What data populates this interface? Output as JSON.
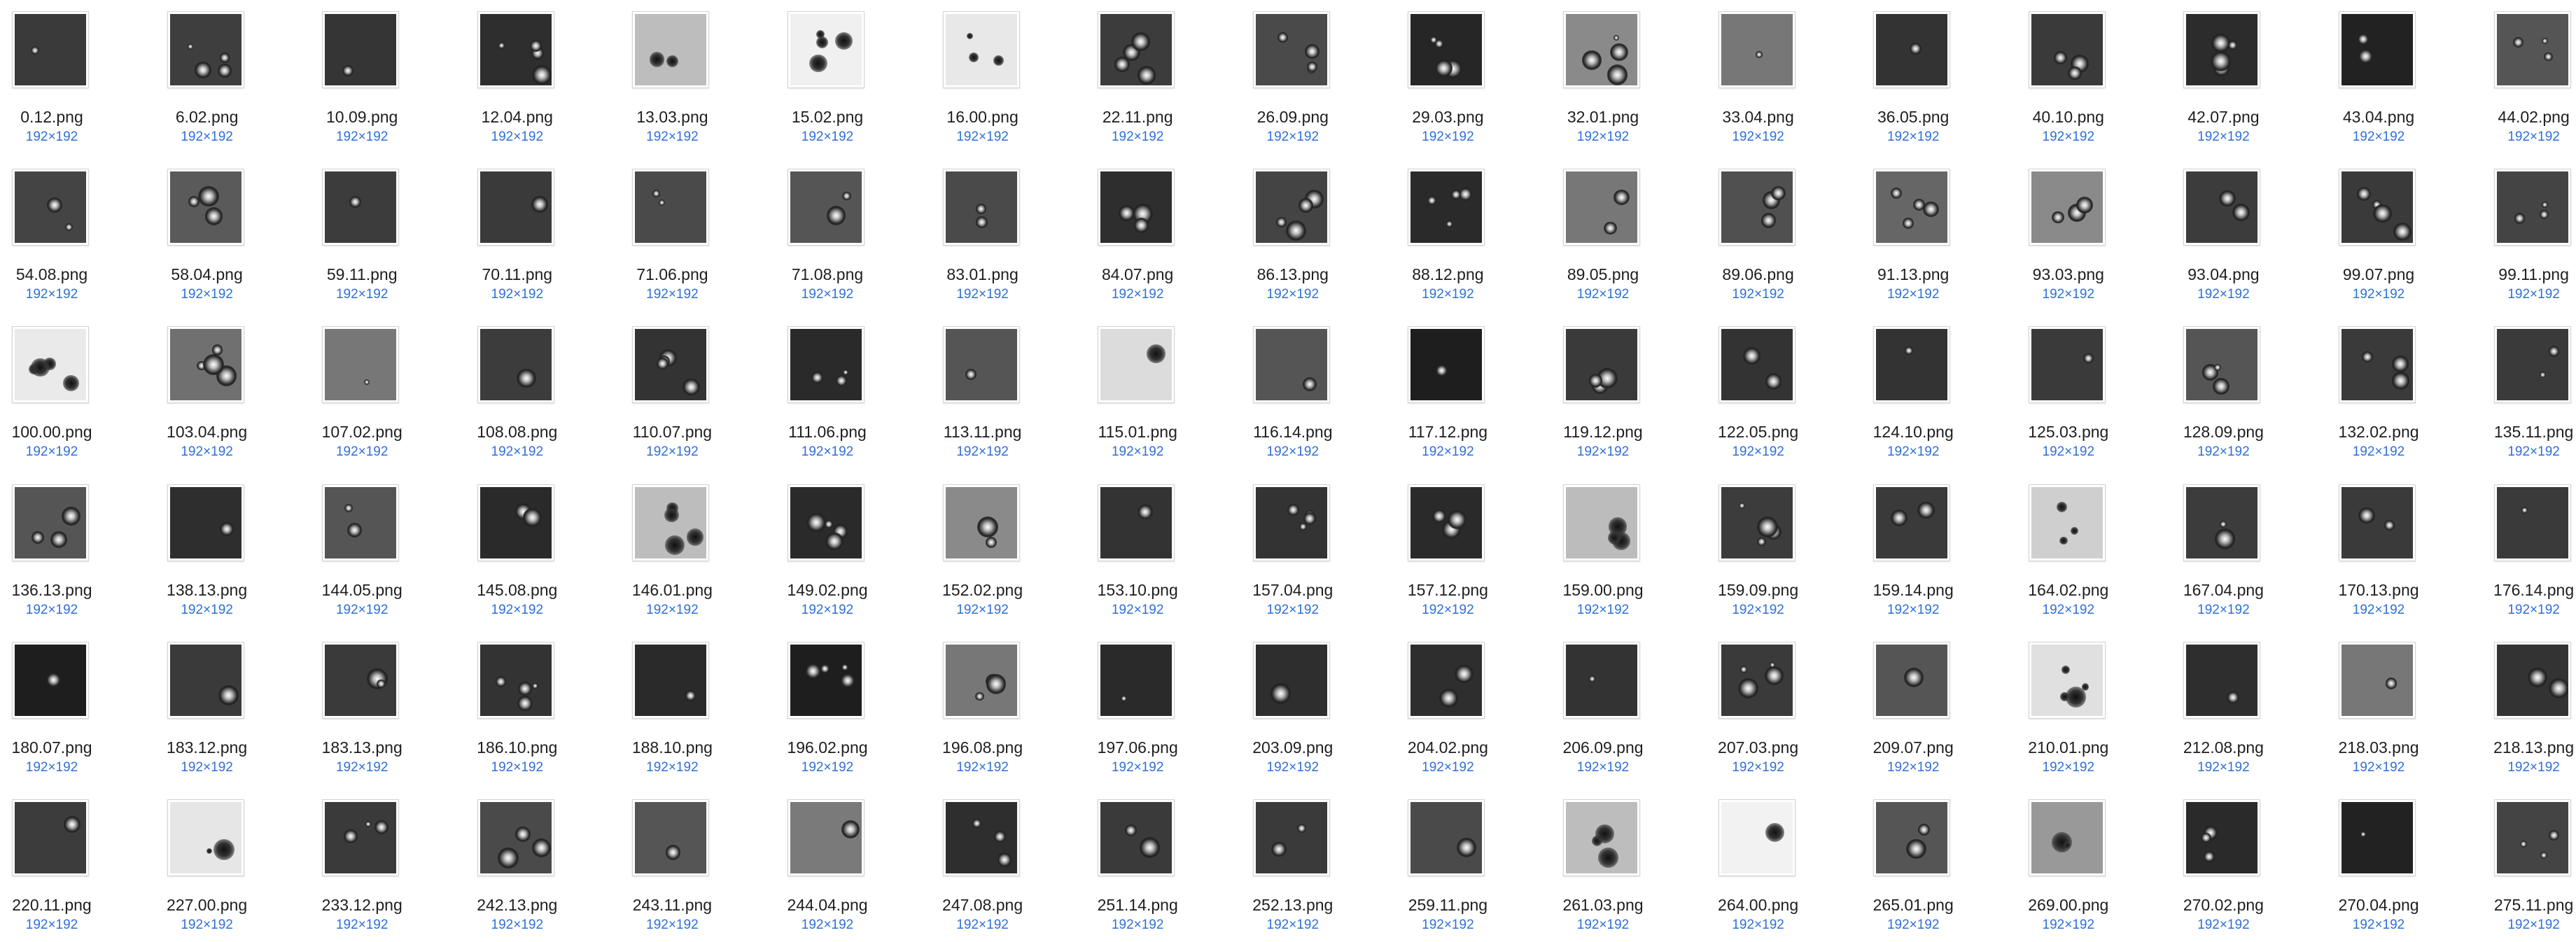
{
  "dimension_label": "192×192",
  "rows": [
    [
      "0.12.png",
      "6.02.png",
      "10.09.png",
      "12.04.png",
      "13.03.png",
      "15.02.png",
      "16.00.png",
      "22.11.png",
      "26.09.png",
      "29.03.png",
      "32.01.png",
      "33.04.png",
      "36.05.png",
      "40.10.png",
      "42.07.png",
      "43.04.png",
      "44.02.png"
    ],
    [
      "54.08.png",
      "58.04.png",
      "59.11.png",
      "70.11.png",
      "71.06.png",
      "71.08.png",
      "83.01.png",
      "84.07.png",
      "86.13.png",
      "88.12.png",
      "89.05.png",
      "89.06.png",
      "91.13.png",
      "93.03.png",
      "93.04.png",
      "99.07.png",
      "99.11.png"
    ],
    [
      "100.00.png",
      "103.04.png",
      "107.02.png",
      "108.08.png",
      "110.07.png",
      "111.06.png",
      "113.11.png",
      "115.01.png",
      "116.14.png",
      "117.12.png",
      "119.12.png",
      "122.05.png",
      "124.10.png",
      "125.03.png",
      "128.09.png",
      "132.02.png",
      "135.11.png"
    ],
    [
      "136.13.png",
      "138.13.png",
      "144.05.png",
      "145.08.png",
      "146.01.png",
      "149.02.png",
      "152.02.png",
      "153.10.png",
      "157.04.png",
      "157.12.png",
      "159.00.png",
      "159.09.png",
      "159.14.png",
      "164.02.png",
      "167.04.png",
      "170.13.png",
      "176.14.png"
    ],
    [
      "180.07.png",
      "183.12.png",
      "183.13.png",
      "186.10.png",
      "188.10.png",
      "196.02.png",
      "196.08.png",
      "197.06.png",
      "203.09.png",
      "204.02.png",
      "206.09.png",
      "207.03.png",
      "209.07.png",
      "210.01.png",
      "212.08.png",
      "218.03.png",
      "218.13.png"
    ],
    [
      "220.11.png",
      "227.00.png",
      "233.12.png",
      "242.13.png",
      "243.11.png",
      "244.04.png",
      "247.08.png",
      "251.14.png",
      "252.13.png",
      "259.11.png",
      "261.03.png",
      "264.00.png",
      "265.01.png",
      "269.00.png",
      "270.02.png",
      "270.04.png",
      "275.11.png"
    ]
  ],
  "thumbnail_backgrounds": [
    [
      "#3a3a3a",
      "#3e3e3e",
      "#353535",
      "#2e2e2e",
      "#bdbdbd",
      "#f0f0f0",
      "#e8e8e8",
      "#3c3c3c",
      "#4a4a4a",
      "#262626",
      "#8a8a8a",
      "#777777",
      "#333333",
      "#3a3a3a",
      "#2c2c2c",
      "#222222",
      "#555555"
    ],
    [
      "#444444",
      "#5a5a5a",
      "#3c3c3c",
      "#3a3a3a",
      "#4a4a4a",
      "#555555",
      "#4a4a4a",
      "#2e2e2e",
      "#444444",
      "#2a2a2a",
      "#777777",
      "#505050",
      "#666666",
      "#8a8a8a",
      "#3c3c3c",
      "#3a3a3a",
      "#444444"
    ],
    [
      "#eaeaea",
      "#707070",
      "#777777",
      "#3c3c3c",
      "#333333",
      "#2a2a2a",
      "#555555",
      "#dcdcdc",
      "#555555",
      "#1e1e1e",
      "#3a3a3a",
      "#333333",
      "#333333",
      "#3a3a3a",
      "#555555",
      "#3a3a3a",
      "#3a3a3a"
    ],
    [
      "#555555",
      "#2e2e2e",
      "#555555",
      "#2a2a2a",
      "#bdbdbd",
      "#2a2a2a",
      "#8a8a8a",
      "#333333",
      "#333333",
      "#2a2a2a",
      "#bcbcbc",
      "#3c3c3c",
      "#3a3a3a",
      "#cfcfcf",
      "#3c3c3c",
      "#3a3a3a",
      "#3a3a3a"
    ],
    [
      "#1e1e1e",
      "#3a3a3a",
      "#3a3a3a",
      "#333333",
      "#2a2a2a",
      "#1e1e1e",
      "#777777",
      "#2a2a2a",
      "#2e2e2e",
      "#2e2e2e",
      "#333333",
      "#3a3a3a",
      "#555555",
      "#e0e0e0",
      "#2e2e2e",
      "#777777",
      "#333333"
    ],
    [
      "#3c3c3c",
      "#e6e6e6",
      "#3a3a3a",
      "#4a4a4a",
      "#555555",
      "#7a7a7a",
      "#2e2e2e",
      "#3a3a3a",
      "#3a3a3a",
      "#4a4a4a",
      "#bdbdbd",
      "#f2f2f2",
      "#555555",
      "#999999",
      "#2a2a2a",
      "#222222",
      "#444444"
    ]
  ]
}
